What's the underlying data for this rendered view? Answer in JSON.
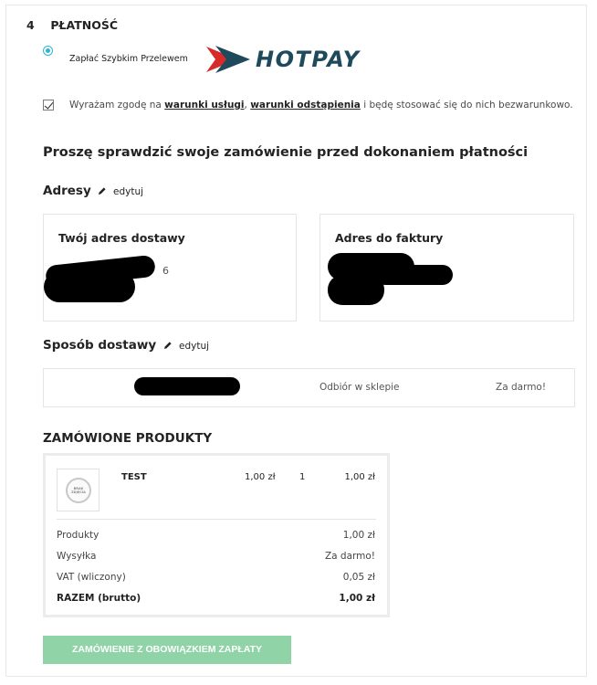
{
  "step": {
    "number": "4",
    "title": "PŁATNOŚĆ"
  },
  "payment": {
    "option_label": "Zapłać Szybkim Przelewem",
    "logo_text": "HOTPAY",
    "selected": true
  },
  "consent": {
    "checked": true,
    "prefix": "Wyrażam zgodę na ",
    "link1": "warunki usługi",
    "sep": ", ",
    "link2": "warunki odstąpienia",
    "suffix": " i będę stosować się do nich bezwarunkowo."
  },
  "review_title": "Proszę sprawdzić swoje zamówienie przed dokonaniem płatności",
  "addresses": {
    "title": "Adresy",
    "edit": "edytuj",
    "delivery_title": "Twój adres dostawy",
    "delivery_visible_fragment": "6",
    "invoice_title": "Adres do faktury"
  },
  "shipping": {
    "title": "Sposób dostawy",
    "edit": "edytuj",
    "method": "Odbiór w sklepie",
    "price": "Za darmo!"
  },
  "products": {
    "title": "ZAMÓWIONE PRODUKTY",
    "items": [
      {
        "name": "TEST",
        "unit_price": "1,00 zł",
        "qty": "1",
        "total": "1,00 zł",
        "thumb_text": "BRAK ZDJĘCIA"
      }
    ],
    "summary": [
      {
        "label": "Produkty",
        "value": "1,00 zł"
      },
      {
        "label": "Wysyłka",
        "value": "Za darmo!"
      },
      {
        "label": "VAT (wliczony)",
        "value": "0,05 zł"
      },
      {
        "label": "RAZEM (brutto)",
        "value": "1,00 zł"
      }
    ]
  },
  "order_button": "ZAMÓWIENIE Z OBOWIĄZKIEM ZAPŁATY",
  "colors": {
    "accent": "#2fb5d2",
    "button": "#8fd3a7",
    "hotpay_red": "#d52b2b",
    "hotpay_navy": "#1e4a5c"
  }
}
